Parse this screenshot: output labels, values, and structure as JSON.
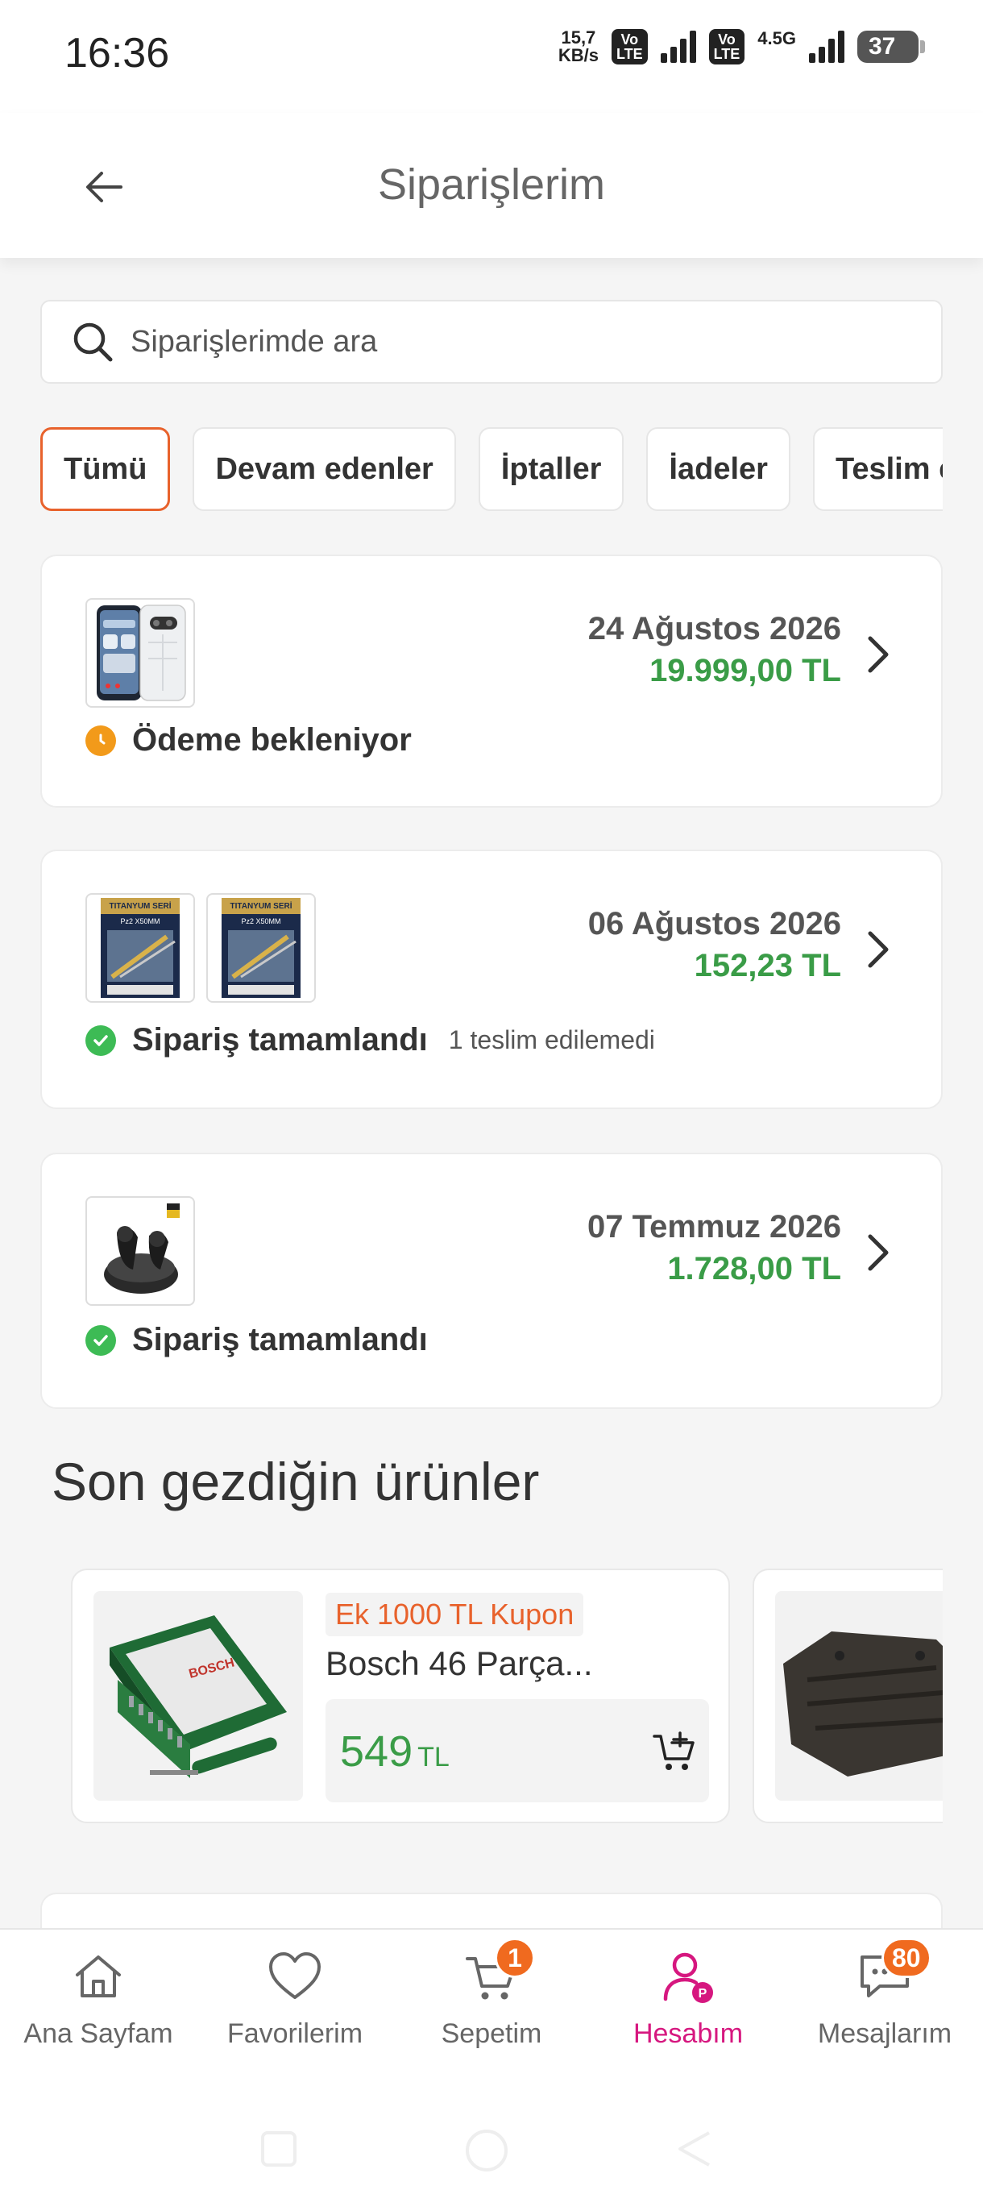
{
  "status_bar": {
    "time": "16:36",
    "net_speed_value": "15,7",
    "net_speed_unit": "KB/s",
    "volte1_top": "Vo",
    "volte1_bottom": "LTE",
    "volte2_top": "Vo",
    "volte2_bottom": "LTE",
    "network_type": "4.5G",
    "battery": "37"
  },
  "header": {
    "title": "Siparişlerim"
  },
  "search": {
    "placeholder": "Siparişlerimde ara"
  },
  "filter_tabs": [
    {
      "label": "Tümü",
      "active": true
    },
    {
      "label": "Devam edenler",
      "active": false
    },
    {
      "label": "İptaller",
      "active": false
    },
    {
      "label": "İadeler",
      "active": false
    },
    {
      "label": "Teslim edilenler",
      "active": false
    }
  ],
  "orders": [
    {
      "date": "24 Ağustos 2026",
      "price": "19.999,00 TL",
      "status": "Ödeme bekleniyor",
      "status_color": "#f29a1a",
      "note": ""
    },
    {
      "date": "06 Ağustos 2026",
      "price": "152,23 TL",
      "status": "Sipariş tamamlandı",
      "status_color": "#3dbb55",
      "note": "1 teslim edilemedi"
    },
    {
      "date": "07 Temmuz 2026",
      "price": "1.728,00 TL",
      "status": "Sipariş tamamlandı",
      "status_color": "#3dbb55",
      "note": ""
    }
  ],
  "product_labels": {
    "bit_title": "TITANYUM SERİ",
    "bit_sub": "Pz2 X50MM",
    "bosch": "BOSCH"
  },
  "recently_viewed": {
    "title": "Son gezdiğin ürünler",
    "items": [
      {
        "coupon": "Ek 1000 TL Kupon",
        "name": "Bosch 46 Parça...",
        "price": "549",
        "currency": "TL"
      }
    ]
  },
  "bottom_nav": [
    {
      "label": "Ana Sayfam",
      "icon": "home-icon",
      "badge": ""
    },
    {
      "label": "Favorilerim",
      "icon": "heart-icon",
      "badge": ""
    },
    {
      "label": "Sepetim",
      "icon": "cart-icon",
      "badge": "1"
    },
    {
      "label": "Hesabım",
      "icon": "account-icon",
      "badge": ""
    },
    {
      "label": "Mesajlarım",
      "icon": "message-icon",
      "badge": "80"
    }
  ],
  "colors": {
    "accent_orange": "#e8622c",
    "price_green": "#3a9c47",
    "active_nav": "#d6177f",
    "badge": "#f06a1f"
  }
}
